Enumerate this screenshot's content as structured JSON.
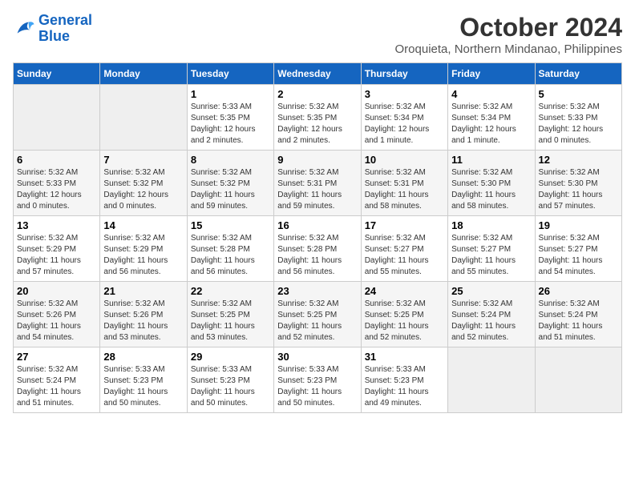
{
  "header": {
    "logo_line1": "General",
    "logo_line2": "Blue",
    "month": "October 2024",
    "location": "Oroquieta, Northern Mindanao, Philippines"
  },
  "days_of_week": [
    "Sunday",
    "Monday",
    "Tuesday",
    "Wednesday",
    "Thursday",
    "Friday",
    "Saturday"
  ],
  "weeks": [
    [
      {
        "day": "",
        "content": ""
      },
      {
        "day": "",
        "content": ""
      },
      {
        "day": "1",
        "content": "Sunrise: 5:33 AM\nSunset: 5:35 PM\nDaylight: 12 hours\nand 2 minutes."
      },
      {
        "day": "2",
        "content": "Sunrise: 5:32 AM\nSunset: 5:35 PM\nDaylight: 12 hours\nand 2 minutes."
      },
      {
        "day": "3",
        "content": "Sunrise: 5:32 AM\nSunset: 5:34 PM\nDaylight: 12 hours\nand 1 minute."
      },
      {
        "day": "4",
        "content": "Sunrise: 5:32 AM\nSunset: 5:34 PM\nDaylight: 12 hours\nand 1 minute."
      },
      {
        "day": "5",
        "content": "Sunrise: 5:32 AM\nSunset: 5:33 PM\nDaylight: 12 hours\nand 0 minutes."
      }
    ],
    [
      {
        "day": "6",
        "content": "Sunrise: 5:32 AM\nSunset: 5:33 PM\nDaylight: 12 hours\nand 0 minutes."
      },
      {
        "day": "7",
        "content": "Sunrise: 5:32 AM\nSunset: 5:32 PM\nDaylight: 12 hours\nand 0 minutes."
      },
      {
        "day": "8",
        "content": "Sunrise: 5:32 AM\nSunset: 5:32 PM\nDaylight: 11 hours\nand 59 minutes."
      },
      {
        "day": "9",
        "content": "Sunrise: 5:32 AM\nSunset: 5:31 PM\nDaylight: 11 hours\nand 59 minutes."
      },
      {
        "day": "10",
        "content": "Sunrise: 5:32 AM\nSunset: 5:31 PM\nDaylight: 11 hours\nand 58 minutes."
      },
      {
        "day": "11",
        "content": "Sunrise: 5:32 AM\nSunset: 5:30 PM\nDaylight: 11 hours\nand 58 minutes."
      },
      {
        "day": "12",
        "content": "Sunrise: 5:32 AM\nSunset: 5:30 PM\nDaylight: 11 hours\nand 57 minutes."
      }
    ],
    [
      {
        "day": "13",
        "content": "Sunrise: 5:32 AM\nSunset: 5:29 PM\nDaylight: 11 hours\nand 57 minutes."
      },
      {
        "day": "14",
        "content": "Sunrise: 5:32 AM\nSunset: 5:29 PM\nDaylight: 11 hours\nand 56 minutes."
      },
      {
        "day": "15",
        "content": "Sunrise: 5:32 AM\nSunset: 5:28 PM\nDaylight: 11 hours\nand 56 minutes."
      },
      {
        "day": "16",
        "content": "Sunrise: 5:32 AM\nSunset: 5:28 PM\nDaylight: 11 hours\nand 56 minutes."
      },
      {
        "day": "17",
        "content": "Sunrise: 5:32 AM\nSunset: 5:27 PM\nDaylight: 11 hours\nand 55 minutes."
      },
      {
        "day": "18",
        "content": "Sunrise: 5:32 AM\nSunset: 5:27 PM\nDaylight: 11 hours\nand 55 minutes."
      },
      {
        "day": "19",
        "content": "Sunrise: 5:32 AM\nSunset: 5:27 PM\nDaylight: 11 hours\nand 54 minutes."
      }
    ],
    [
      {
        "day": "20",
        "content": "Sunrise: 5:32 AM\nSunset: 5:26 PM\nDaylight: 11 hours\nand 54 minutes."
      },
      {
        "day": "21",
        "content": "Sunrise: 5:32 AM\nSunset: 5:26 PM\nDaylight: 11 hours\nand 53 minutes."
      },
      {
        "day": "22",
        "content": "Sunrise: 5:32 AM\nSunset: 5:25 PM\nDaylight: 11 hours\nand 53 minutes."
      },
      {
        "day": "23",
        "content": "Sunrise: 5:32 AM\nSunset: 5:25 PM\nDaylight: 11 hours\nand 52 minutes."
      },
      {
        "day": "24",
        "content": "Sunrise: 5:32 AM\nSunset: 5:25 PM\nDaylight: 11 hours\nand 52 minutes."
      },
      {
        "day": "25",
        "content": "Sunrise: 5:32 AM\nSunset: 5:24 PM\nDaylight: 11 hours\nand 52 minutes."
      },
      {
        "day": "26",
        "content": "Sunrise: 5:32 AM\nSunset: 5:24 PM\nDaylight: 11 hours\nand 51 minutes."
      }
    ],
    [
      {
        "day": "27",
        "content": "Sunrise: 5:32 AM\nSunset: 5:24 PM\nDaylight: 11 hours\nand 51 minutes."
      },
      {
        "day": "28",
        "content": "Sunrise: 5:33 AM\nSunset: 5:23 PM\nDaylight: 11 hours\nand 50 minutes."
      },
      {
        "day": "29",
        "content": "Sunrise: 5:33 AM\nSunset: 5:23 PM\nDaylight: 11 hours\nand 50 minutes."
      },
      {
        "day": "30",
        "content": "Sunrise: 5:33 AM\nSunset: 5:23 PM\nDaylight: 11 hours\nand 50 minutes."
      },
      {
        "day": "31",
        "content": "Sunrise: 5:33 AM\nSunset: 5:23 PM\nDaylight: 11 hours\nand 49 minutes."
      },
      {
        "day": "",
        "content": ""
      },
      {
        "day": "",
        "content": ""
      }
    ]
  ]
}
